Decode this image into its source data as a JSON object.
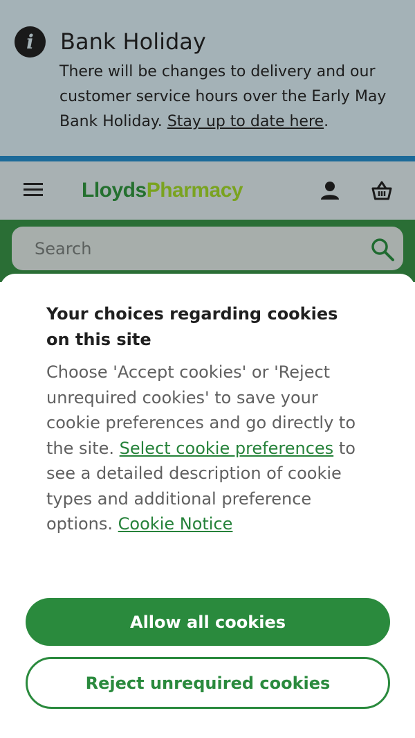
{
  "banner": {
    "icon": "info-icon",
    "icon_glyph": "i",
    "title": "Bank Holiday",
    "text": "There will be changes to delivery and our customer service hours over the Early May Bank Holiday.",
    "link_text": "Stay up to date here",
    "trailing": "."
  },
  "header": {
    "menu_icon": "hamburger-menu-icon",
    "logo_part1": "Lloyds",
    "logo_part2": "Pharmacy",
    "account_icon": "user-icon",
    "basket_icon": "basket-icon"
  },
  "search": {
    "placeholder": "Search",
    "icon": "search-icon"
  },
  "cookie": {
    "title": "Your choices regarding cookies on this site",
    "body_1": "Choose 'Accept cookies' or 'Reject unrequired cookies' to save your cookie preferences and go directly to the site.",
    "link_preferences": "Select cookie preferences",
    "body_2": "to see a detailed description of cookie types and additional preference options.",
    "link_notice": "Cookie Notice",
    "allow_label": "Allow all cookies",
    "reject_label": "Reject unrequired cookies"
  },
  "colors": {
    "brand_green": "#2a8a3d",
    "logo_dark_green": "#24702f",
    "logo_light_green": "#7aa320",
    "banner_bg": "#a4b2b7",
    "banner_rule": "#1c6a99",
    "header_bg": "#a8b1b3",
    "search_strip": "#2a6e35"
  }
}
